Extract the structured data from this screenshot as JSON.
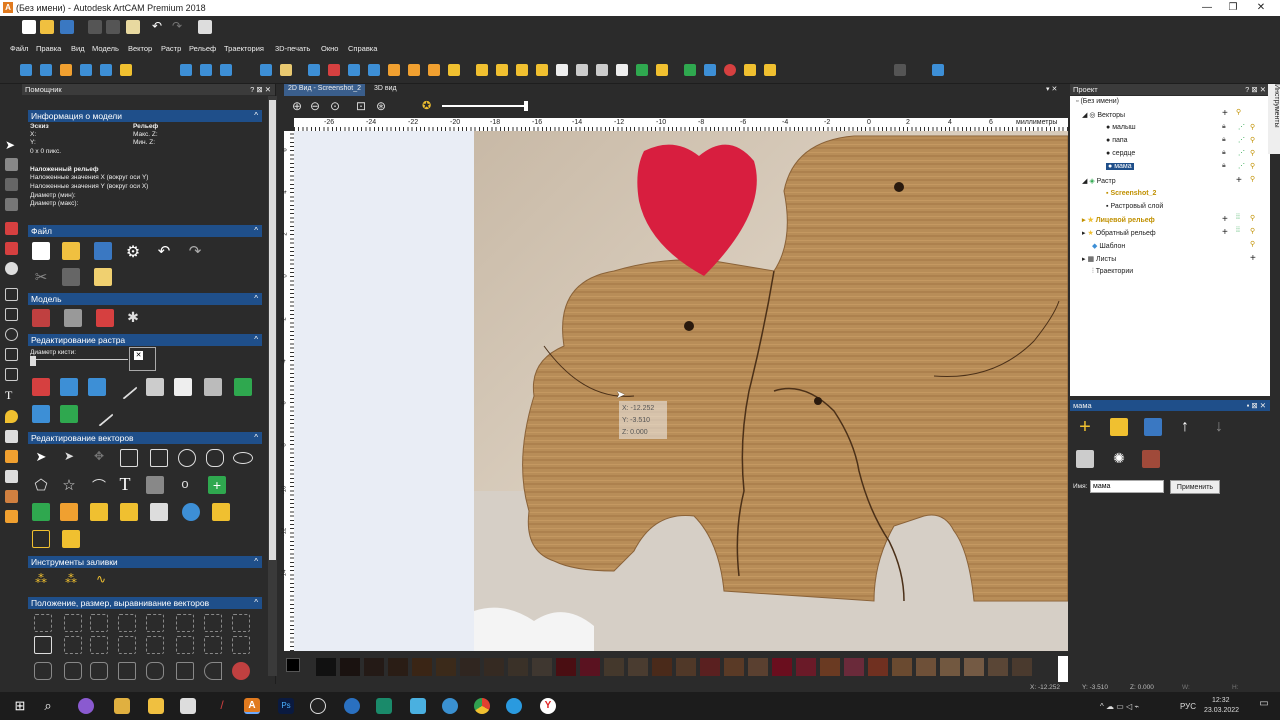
{
  "window": {
    "title": "(Без имени) - Autodesk ArtCAM Premium 2018",
    "logo": "A"
  },
  "menu": [
    "Файл",
    "Правка",
    "Вид",
    "Модель",
    "Вектор",
    "Растр",
    "Рельеф",
    "Траектория",
    "3D-печать",
    "Окно",
    "Справка"
  ],
  "assistant": {
    "panel_title": "Помощник",
    "model_info": {
      "header": "Информация о модели",
      "sketch_label": "Эскиз",
      "x_label": "X:",
      "y_label": "Y:",
      "size": "0 x 0 пикс.",
      "relief_label": "Рельеф",
      "max_z": "Макс. Z:",
      "min_z": "Мин. Z:",
      "overlay_title": "Наложенный рельеф",
      "overlay_x": "Наложенные значения X (вокруг оси Y)",
      "overlay_y": "Наложенные значения Y (вокруг оси X)",
      "diam_min": "Диаметр (мин):",
      "diam_max": "Диаметр (макс):"
    },
    "sections": {
      "file": "Файл",
      "model": "Модель",
      "raster_edit": "Редактирование растра",
      "brush_diameter": "Диаметр кисти:",
      "vector_edit": "Редактирование векторов",
      "fill_tools": "Инструменты заливки",
      "position": "Положение, размер, выравнивание векторов"
    }
  },
  "view": {
    "tabs": [
      "2D Вид - Screenshot_2",
      "3D вид"
    ],
    "ruler_labels": [
      "-26",
      "-24",
      "-22",
      "-20",
      "-18",
      "-16",
      "-14",
      "-12",
      "-10",
      "-8",
      "-6",
      "-4",
      "-2",
      "0",
      "2",
      "4",
      "6"
    ],
    "ruler_unit": "миллиметры",
    "vruler_labels": [
      "6",
      "4",
      "2",
      "0",
      "-2",
      "-4",
      "-6",
      "-8",
      "-10",
      "-12",
      "-14"
    ],
    "tooltip": {
      "x": "X: -12.252",
      "y": "Y: -3.510",
      "z": "Z: 0.000"
    }
  },
  "project": {
    "panel_title": "Проект",
    "side_tab": "Инструменты",
    "tree": {
      "root": "(Без имени)",
      "vectors": "Векторы",
      "vector_items": [
        "малыш",
        "папа",
        "сердце",
        "мама"
      ],
      "raster": "Растр",
      "raster_items": [
        "Screenshot_2",
        "Растровый слой"
      ],
      "front_relief": "Лицевой рельеф",
      "back_relief": "Обратный рельеф",
      "template": "Шаблон",
      "sheets": "Листы",
      "toolpaths": "Траектории"
    }
  },
  "layer": {
    "panel_title": "мама",
    "name_label": "Имя:",
    "name_value": "мама",
    "apply_label": "Применить"
  },
  "status": {
    "x": "X: -12.252",
    "y": "Y: -3.510",
    "z": "Z: 0.000",
    "w": "W:",
    "h": "H:"
  },
  "taskbar": {
    "lang": "РУС",
    "time": "12:32",
    "date": "23.03.2022"
  },
  "colors": {
    "accent": "#1f4f8a",
    "heart": "#d81e3f",
    "wood": "#b78f5d"
  }
}
